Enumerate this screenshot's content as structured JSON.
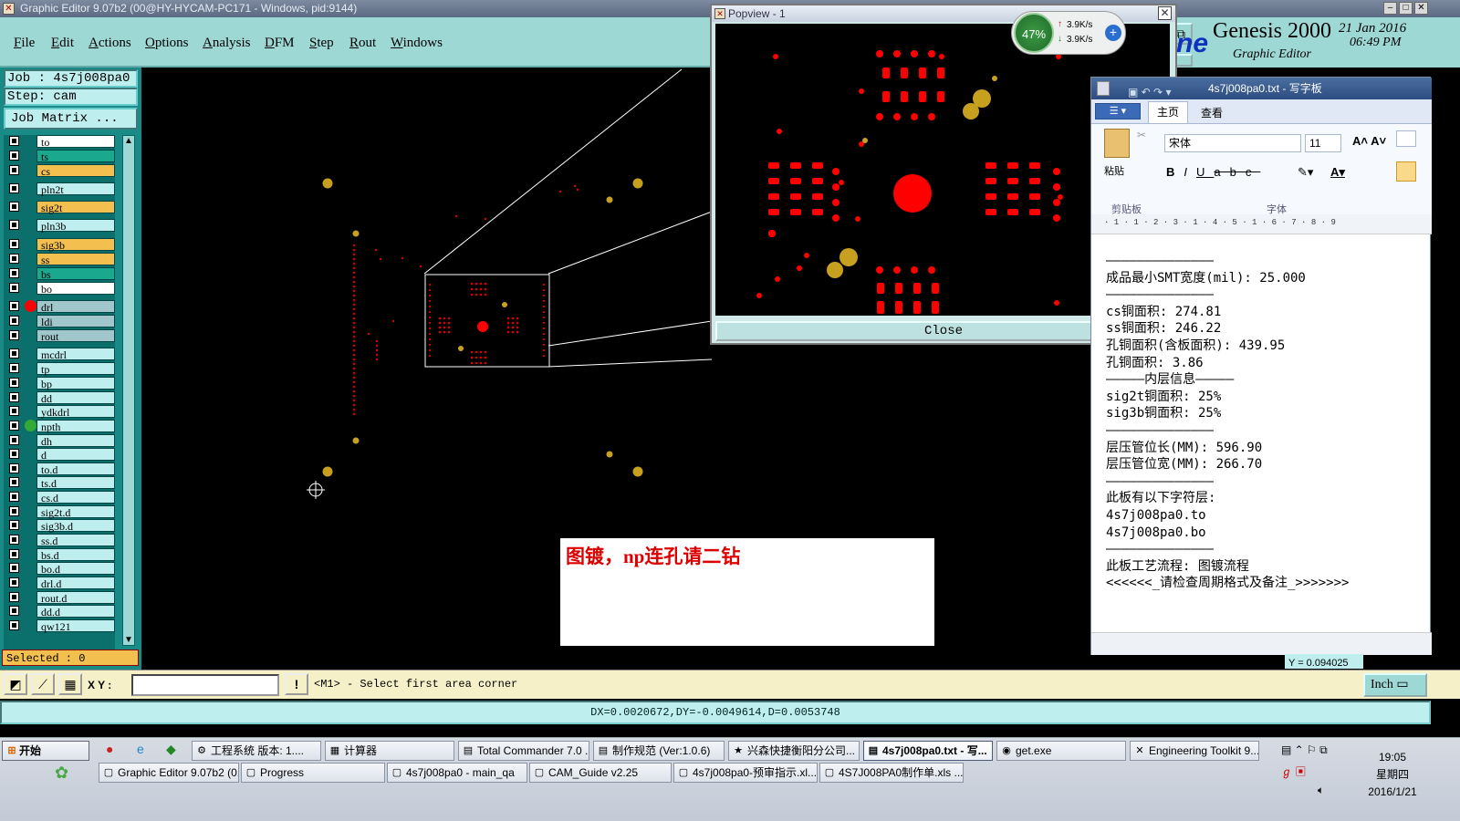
{
  "main_title": "Graphic Editor 9.07b2 (00@HY-HYCAM-PC171 - Windows, pid:9144)",
  "menu": [
    "File",
    "Edit",
    "Actions",
    "Options",
    "Analysis",
    "DFM",
    "Step",
    "Rout",
    "Windows"
  ],
  "job_label": "Job : 4s7j008pa0",
  "step_label": "Step: cam",
  "job_matrix": "Job Matrix ...",
  "layers": [
    {
      "name": "to",
      "style": "w"
    },
    {
      "name": "ts",
      "style": "g"
    },
    {
      "name": "cs",
      "style": "y"
    },
    {
      "name": "pln2t",
      "style": "n"
    },
    {
      "name": "sig2t",
      "style": "y"
    },
    {
      "name": "pln3b",
      "style": "n"
    },
    {
      "name": "sig3b",
      "style": "y"
    },
    {
      "name": "ss",
      "style": "y"
    },
    {
      "name": "bs",
      "style": "g"
    },
    {
      "name": "bo",
      "style": "w"
    },
    {
      "name": "drl",
      "style": "s"
    },
    {
      "name": "ldi",
      "style": "s"
    },
    {
      "name": "rout",
      "style": "s"
    },
    {
      "name": "mcdrl",
      "style": "n"
    },
    {
      "name": "tp",
      "style": "n"
    },
    {
      "name": "bp",
      "style": "n"
    },
    {
      "name": "dd",
      "style": "n"
    },
    {
      "name": "ydkdrl",
      "style": "n"
    },
    {
      "name": "npth",
      "style": "n"
    },
    {
      "name": "dh",
      "style": "n"
    },
    {
      "name": "d",
      "style": "n"
    },
    {
      "name": "to.d",
      "style": "n"
    },
    {
      "name": "ts.d",
      "style": "n"
    },
    {
      "name": "cs.d",
      "style": "n"
    },
    {
      "name": "sig2t.d",
      "style": "n"
    },
    {
      "name": "sig3b.d",
      "style": "n"
    },
    {
      "name": "ss.d",
      "style": "n"
    },
    {
      "name": "bs.d",
      "style": "n"
    },
    {
      "name": "bo.d",
      "style": "n"
    },
    {
      "name": "drl.d",
      "style": "n"
    },
    {
      "name": "rout.d",
      "style": "n"
    },
    {
      "name": "dd.d",
      "style": "n"
    },
    {
      "name": "qw121",
      "style": "n"
    }
  ],
  "selected": "Selected : 0",
  "popview_title": "Popview - 1",
  "popview_close": "Close",
  "net_meter": {
    "percent": "47%",
    "up": "3.9K/s",
    "down": "3.9K/s"
  },
  "genesis": {
    "brand": "Genesis 2000",
    "sub": "Graphic Editor",
    "date": "21 Jan 2016",
    "time": "06:49 PM",
    "logo_frag": "ne"
  },
  "wordpad": {
    "title": "4s7j008pa0.txt - 写字板",
    "tabs": [
      "主页",
      "查看"
    ],
    "font_name": "宋体",
    "font_size": "11",
    "paste": "粘贴",
    "clipboard": "剪贴板",
    "font_group": "字体",
    "lines": [
      "——————————————",
      "成品最小SMT宽度(mil): 25.000",
      "——————————————",
      "cs铜面积: 274.81",
      "ss铜面积: 246.22",
      "孔铜面积(含板面积): 439.95",
      "孔铜面积: 3.86",
      "—————内层信息—————",
      "sig2t铜面积: 25%",
      "sig3b铜面积: 25%",
      "——————————————",
      "层压管位长(MM): 596.90",
      "层压管位宽(MM): 266.70",
      "——————————————",
      "此板有以下字符层:",
      "4s7j008pa0.to",
      "4s7j008pa0.bo",
      "——————————————",
      "此板工艺流程: 图镀流程",
      "<<<<<<_请检查周期格式及备注_>>>>>>>"
    ]
  },
  "note": "图镀，np连孔请二钻",
  "cmd": {
    "xy_label": "X Y :",
    "prompt": "<M1> - Select first area corner",
    "unit": "Inch",
    "hidden_readout": "Y = 0.094025"
  },
  "status": "DX=0.0020672,DY=-0.0049614,D=0.0053748",
  "taskbar": {
    "start": "开始",
    "row1": [
      "工程系统 版本: 1....",
      "计算器",
      "Total Commander 7.0 ...",
      "制作规范 (Ver:1.0.6)",
      "兴森快捷衡阳分公司...",
      "4s7j008pa0.txt - 写...",
      "get.exe",
      "Engineering Toolkit 9...."
    ],
    "row2": [
      "Graphic Editor 9.07b2 (0...",
      "Progress",
      "4s7j008pa0 - main_qa",
      "CAM_Guide v2.25",
      "4s7j008pa0-预审指示.xl...",
      "4S7J008PA0制作单.xls ..."
    ],
    "time": "19:05",
    "weekday": "星期四",
    "date": "2016/1/21"
  }
}
